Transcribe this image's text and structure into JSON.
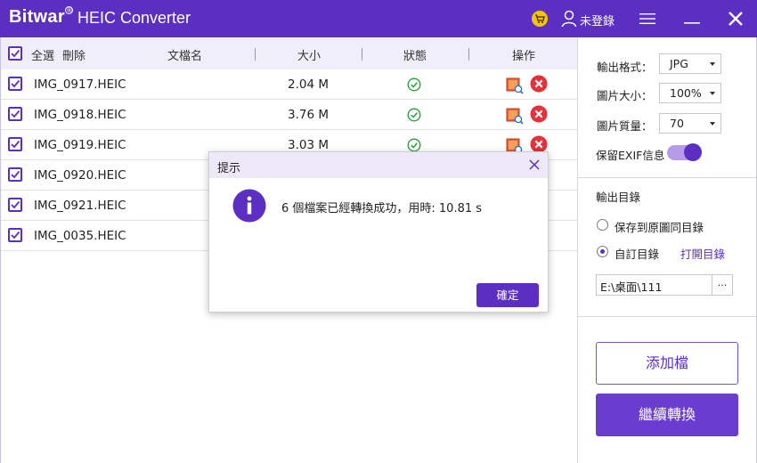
{
  "app": {
    "logo": "Bitwar",
    "registered": "®",
    "title": "HEIC Converter",
    "user_label": "未登錄"
  },
  "list": {
    "select_all": "全選",
    "delete": "刪除",
    "columns": {
      "filename": "文檔名",
      "size": "大小",
      "status": "狀態",
      "action": "操作"
    },
    "rows": [
      {
        "name": "IMG_0917.HEIC",
        "size": "2.04 M"
      },
      {
        "name": "IMG_0918.HEIC",
        "size": "3.76 M"
      },
      {
        "name": "IMG_0919.HEIC",
        "size": "3.03 M"
      },
      {
        "name": "IMG_0920.HEIC",
        "size": ""
      },
      {
        "name": "IMG_0921.HEIC",
        "size": ""
      },
      {
        "name": "IMG_0035.HEIC",
        "size": ""
      }
    ]
  },
  "settings": {
    "format_label": "輸出格式：",
    "format_value": "JPG",
    "size_label": "圖片大小：",
    "size_value": "100%",
    "quality_label": "圖片質量：",
    "quality_value": "70",
    "exif_label": "保留EXIF信息",
    "output_dir_label": "輸出目錄",
    "radio_same": "保存到原圖同目錄",
    "radio_custom": "自訂目錄",
    "open_dir": "打開目錄",
    "path_value": "E:\\桌面\\111",
    "browse": "...",
    "add_file": "添加檔",
    "continue": "繼續轉換"
  },
  "dialog": {
    "title": "提示",
    "message": "6 個檔案已經轉換成功，用時: 10.81 s",
    "ok": "確定"
  },
  "colors": {
    "brand": "#5b2fc1",
    "success": "#2aa33b",
    "danger": "#e8303a"
  }
}
